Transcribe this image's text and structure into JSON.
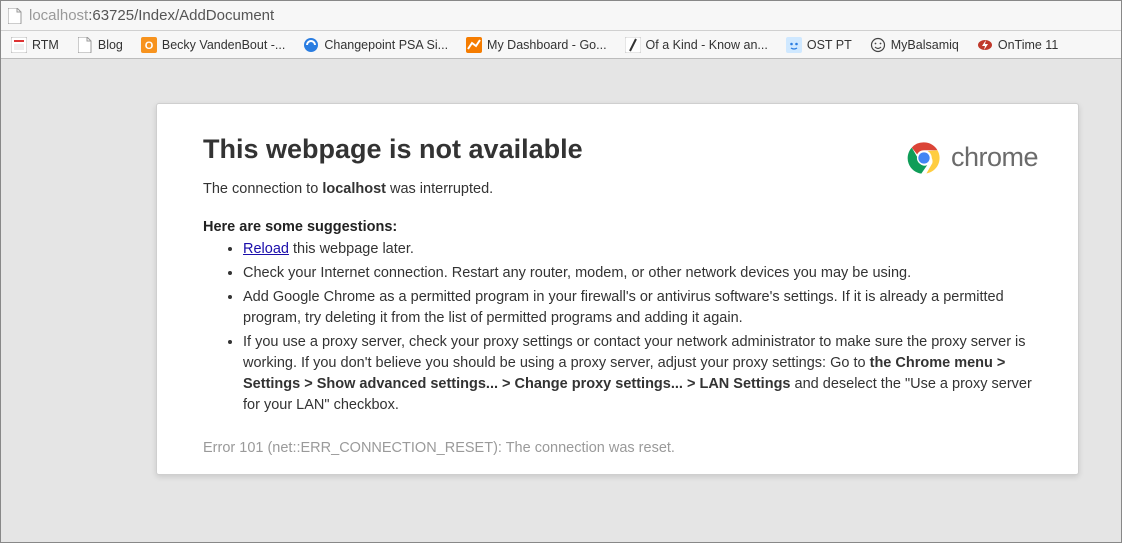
{
  "address": {
    "host": "localhost",
    "port_path": ":63725/Index/AddDocument"
  },
  "bookmarks": [
    {
      "label": "RTM",
      "icon": "rtm"
    },
    {
      "label": "Blog",
      "icon": "page"
    },
    {
      "label": "Becky VandenBout -...",
      "icon": "orange-o"
    },
    {
      "label": "Changepoint PSA Si...",
      "icon": "blue-circle"
    },
    {
      "label": "My Dashboard - Go...",
      "icon": "orange-chart"
    },
    {
      "label": "Of a Kind - Know an...",
      "icon": "slash"
    },
    {
      "label": "OST PT",
      "icon": "face-blue"
    },
    {
      "label": "MyBalsamiq",
      "icon": "smile"
    },
    {
      "label": "OnTime 11",
      "icon": "bolt"
    }
  ],
  "error": {
    "title": "This webpage is not available",
    "brand": "chrome",
    "msg_prefix": "The connection to ",
    "msg_host": "localhost",
    "msg_suffix": " was interrupted.",
    "sugg_header": "Here are some suggestions:",
    "sugg_reload_link": "Reload",
    "sugg_reload_rest": " this webpage later.",
    "sugg_2": "Check your Internet connection. Restart any router, modem, or other network devices you may be using.",
    "sugg_3": "Add Google Chrome as a permitted program in your firewall's or antivirus software's settings. If it is already a permitted program, try deleting it from the list of permitted programs and adding it again.",
    "sugg_4_a": "If you use a proxy server, check your proxy settings or contact your network administrator to make sure the proxy server is working. If you don't believe you should be using a proxy server, adjust your proxy settings: Go to ",
    "sugg_4_bold": "the Chrome menu > Settings > Show advanced settings... > Change proxy settings... > LAN Settings",
    "sugg_4_b": " and deselect the \"Use a proxy server for your LAN\" checkbox.",
    "err_code": "Error 101 (net::ERR_CONNECTION_RESET): The connection was reset."
  }
}
